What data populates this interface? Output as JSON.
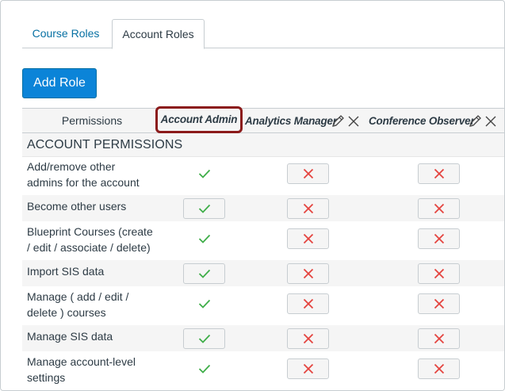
{
  "tabs": [
    {
      "label": "Course Roles",
      "active": false
    },
    {
      "label": "Account Roles",
      "active": true
    }
  ],
  "add_role_label": "Add Role",
  "table": {
    "permissions_header": "Permissions",
    "roles": [
      {
        "name": "Account Admin",
        "highlighted": true
      },
      {
        "name": "Analytics Manager",
        "highlighted": false
      },
      {
        "name": "Conference Observer",
        "highlighted": false
      }
    ],
    "section_title": "ACCOUNT PERMISSIONS",
    "rows": [
      {
        "label_lines": [
          "Add/remove other",
          "admins for the account"
        ],
        "states": [
          "enabled",
          "disabled",
          "disabled"
        ]
      },
      {
        "label_lines": [
          "Become other users"
        ],
        "states": [
          "enabled",
          "disabled",
          "disabled"
        ]
      },
      {
        "label_lines": [
          "Blueprint Courses (create",
          "/ edit / associate / delete)"
        ],
        "states": [
          "enabled",
          "disabled",
          "disabled"
        ]
      },
      {
        "label_lines": [
          "Import SIS data"
        ],
        "states": [
          "enabled",
          "disabled",
          "disabled"
        ]
      },
      {
        "label_lines": [
          "Manage ( add / edit /",
          "delete ) courses"
        ],
        "states": [
          "enabled",
          "disabled",
          "disabled"
        ]
      },
      {
        "label_lines": [
          "Manage SIS data"
        ],
        "states": [
          "enabled",
          "disabled",
          "disabled"
        ]
      },
      {
        "label_lines": [
          "Manage account-level",
          "settings"
        ],
        "states": [
          "enabled",
          "disabled",
          "disabled"
        ]
      }
    ]
  },
  "colors": {
    "link": "#0770a3",
    "button": "#0b84d8",
    "check": "#3fae49",
    "cross": "#e4443f",
    "highlight_border": "#8b1a1a"
  }
}
